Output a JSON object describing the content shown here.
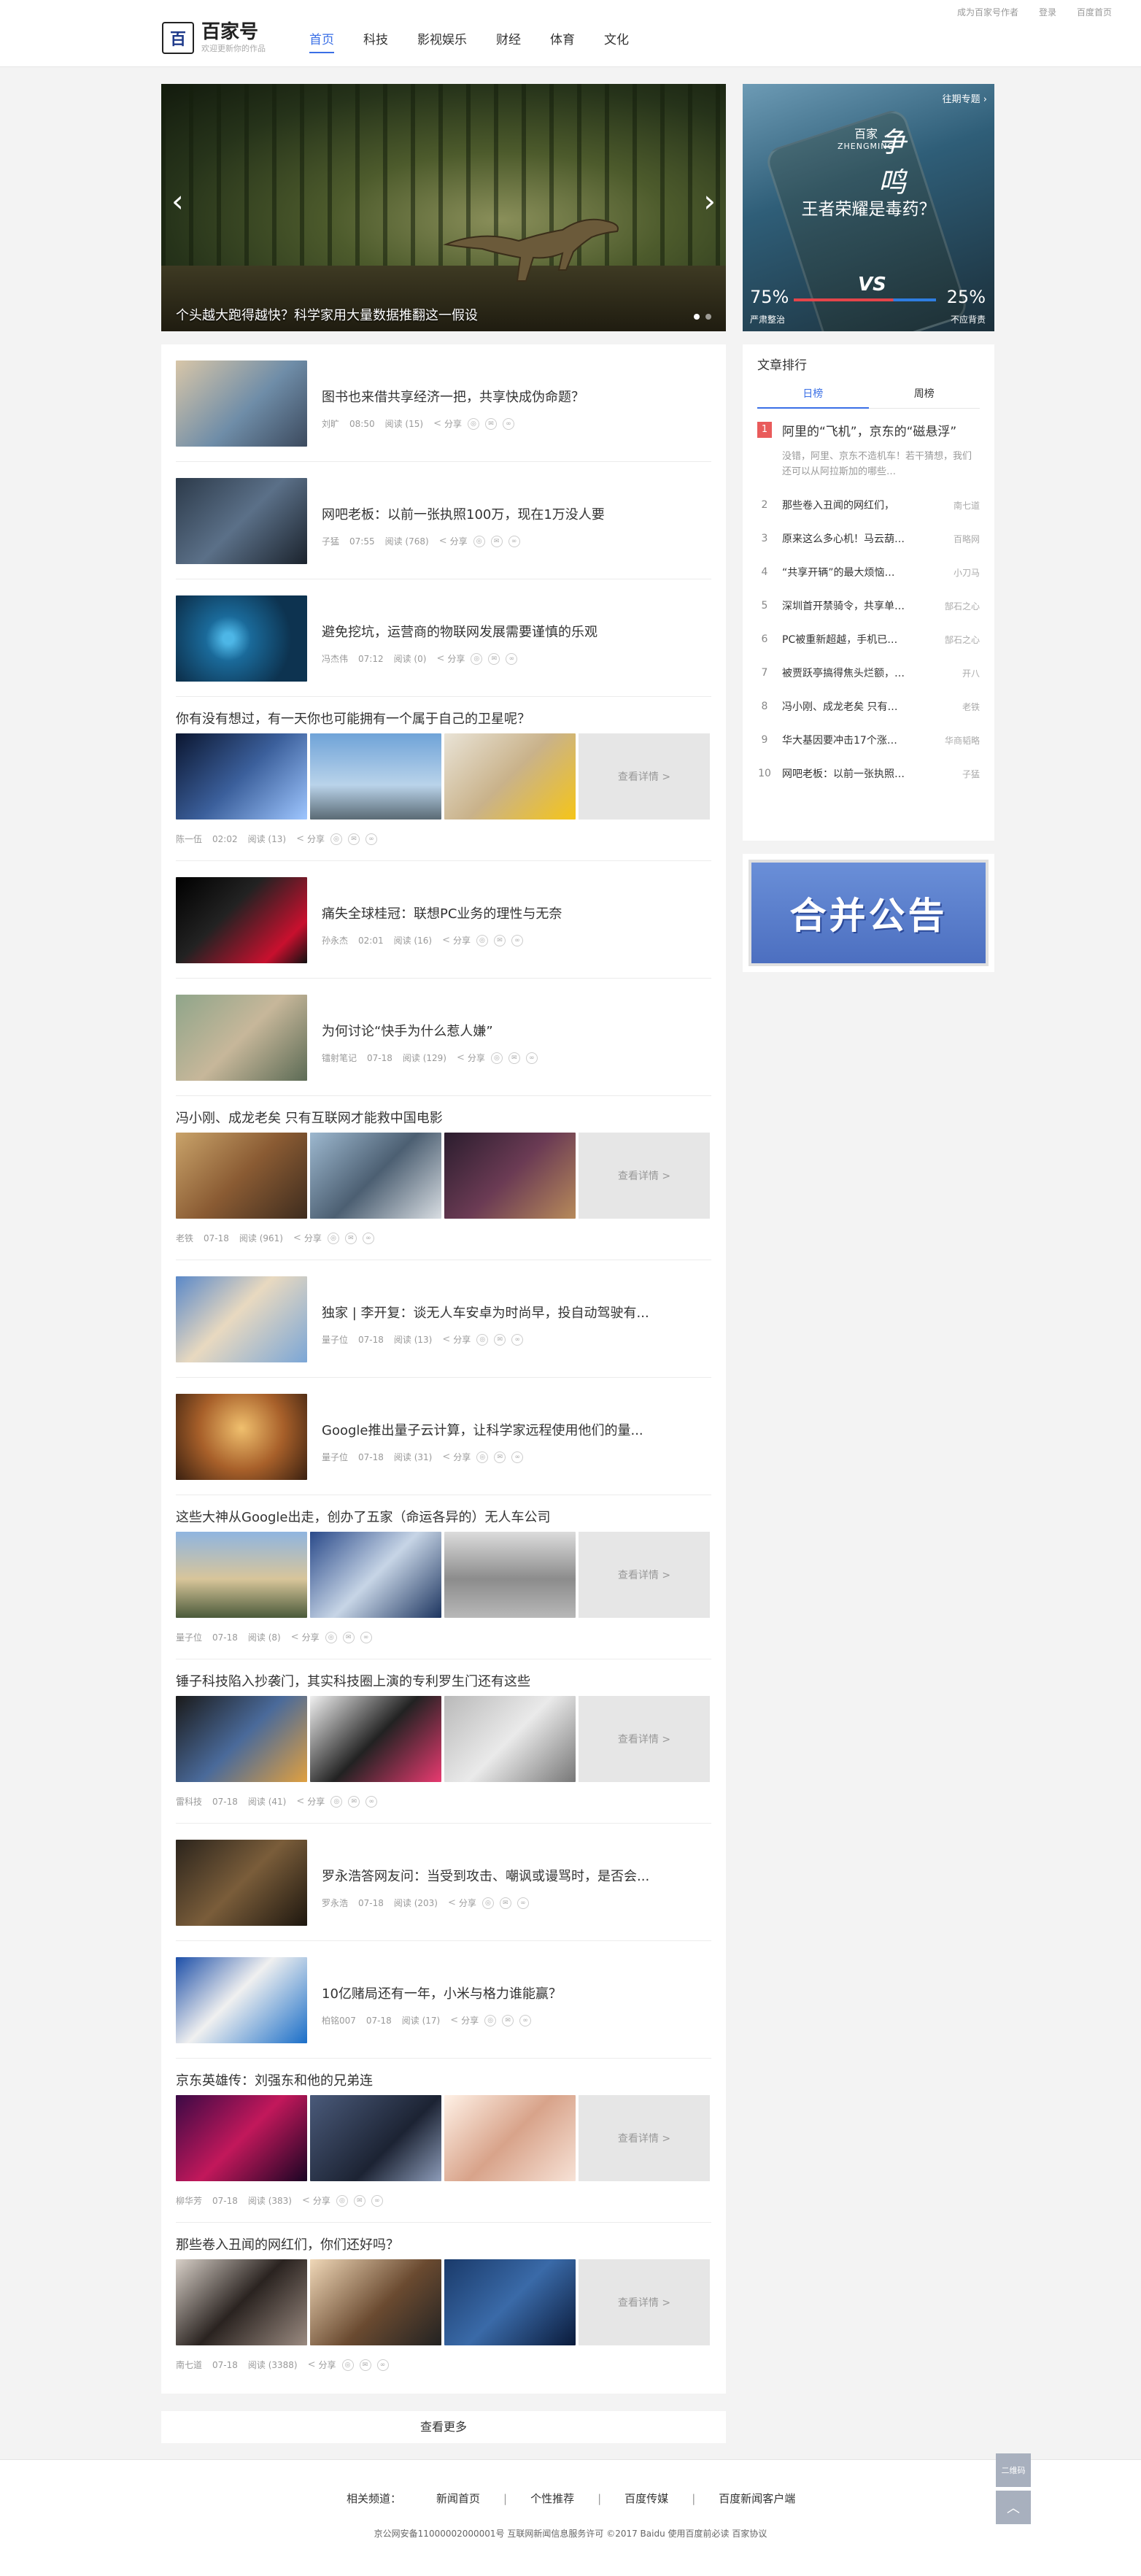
{
  "header": {
    "toplinks": [
      "成为百家号作者",
      "登录",
      "百度首页"
    ],
    "logo_mark": "百",
    "logo_title": "百家号",
    "logo_sub": "欢迎更新你的作品",
    "nav": [
      "首页",
      "科技",
      "影视娱乐",
      "财经",
      "体育",
      "文化"
    ]
  },
  "hero": {
    "caption": "个头越大跑得越快？科学家用大量数据推翻这一假设",
    "prev": "‹",
    "next": "›"
  },
  "special": {
    "top_link": "往期专题 ›",
    "brand": "百家",
    "brand_en": "ZHENGMING",
    "brand_script": "争鸣",
    "question": "王者荣耀是毒药？",
    "vs": "VS",
    "left_pct": "75%",
    "right_pct": "25%",
    "left_label": "严肃整治",
    "right_label": "不应背责"
  },
  "feed": {
    "share_label": "分享",
    "more_label": "查看详情 >",
    "items": [
      {
        "title": "图书也来借共享经济一把，共享快成伪命题？",
        "author": "刘旷",
        "time": "08:50",
        "reads": "阅读 (15)"
      },
      {
        "title": "网吧老板：以前一张执照100万，现在1万没人要",
        "author": "子猛",
        "time": "07:55",
        "reads": "阅读 (768)"
      },
      {
        "title": "避免挖坑，运营商的物联网发展需要谨慎的乐观",
        "author": "冯杰伟",
        "time": "07:12",
        "reads": "阅读 (0)"
      },
      {
        "title": "你有没有想过，有一天你也可能拥有一个属于自己的卫星呢？",
        "author": "陈一伍",
        "time": "02:02",
        "reads": "阅读 (13)"
      },
      {
        "title": "痛失全球桂冠：联想PC业务的理性与无奈",
        "author": "孙永杰",
        "time": "02:01",
        "reads": "阅读 (16)"
      },
      {
        "title": "为何讨论“快手为什么惹人嫌”",
        "author": "镭射笔记",
        "time": "07-18",
        "reads": "阅读 (129)"
      },
      {
        "title": "冯小刚、成龙老矣 只有互联网才能救中国电影",
        "author": "老铁",
        "time": "07-18",
        "reads": "阅读 (961)"
      },
      {
        "title": "独家 | 李开复：谈无人车安卓为时尚早，投自动驾驶有...",
        "author": "量子位",
        "time": "07-18",
        "reads": "阅读 (13)"
      },
      {
        "title": "Google推出量子云计算，让科学家远程使用他们的量...",
        "author": "量子位",
        "time": "07-18",
        "reads": "阅读 (31)"
      },
      {
        "title": "这些大神从Google出走，创办了五家（命运各异的）无人车公司",
        "author": "量子位",
        "time": "07-18",
        "reads": "阅读 (8)"
      },
      {
        "title": "锤子科技陷入抄袭门，其实科技圈上演的专利罗生门还有这些",
        "author": "雷科技",
        "time": "07-18",
        "reads": "阅读 (41)"
      },
      {
        "title": "罗永浩答网友问：当受到攻击、嘲讽或谩骂时，是否会...",
        "author": "罗永浩",
        "time": "07-18",
        "reads": "阅读 (203)"
      },
      {
        "title": "10亿赌局还有一年，小米与格力谁能赢？",
        "author": "柏铭007",
        "time": "07-18",
        "reads": "阅读 (17)"
      },
      {
        "title": "京东英雄传：刘强东和他的兄弟连",
        "author": "柳华芳",
        "time": "07-18",
        "reads": "阅读 (383)"
      },
      {
        "title": "那些卷入丑闻的网红们，你们还好吗？",
        "author": "南七道",
        "time": "07-18",
        "reads": "阅读 (3388)"
      }
    ],
    "load_more": "查看更多"
  },
  "rank": {
    "title": "文章排行",
    "tabs": [
      "日榜",
      "周榜"
    ],
    "first": {
      "num": "1",
      "title": "阿里的“飞机”，京东的“磁悬浮”",
      "desc": "没错，阿里、京东不造机车！若干猜想，我们还可以从阿拉斯加的哪些…"
    },
    "items": [
      {
        "num": "2",
        "title": "那些卷入丑闻的网红们，",
        "src": "南七道"
      },
      {
        "num": "3",
        "title": "原来这么多心机！马云葫…",
        "src": "百略网"
      },
      {
        "num": "4",
        "title": "“共享开辆”的最大烦恼…",
        "src": "小刀马"
      },
      {
        "num": "5",
        "title": "深圳首开禁骑令，共享单…",
        "src": "郜石之心"
      },
      {
        "num": "6",
        "title": "PC被重新超越，手机已…",
        "src": "郜石之心"
      },
      {
        "num": "7",
        "title": "被贾跃亭搞得焦头烂额，…",
        "src": "开八"
      },
      {
        "num": "8",
        "title": "冯小刚、成龙老矣 只有…",
        "src": "老铁"
      },
      {
        "num": "9",
        "title": "华大基因要冲击17个涨…",
        "src": "华商韬略"
      },
      {
        "num": "10",
        "title": "网吧老板：以前一张执照…",
        "src": "子猛"
      }
    ]
  },
  "notice": {
    "text": "合并公告"
  },
  "footer": {
    "label": "相关频道：",
    "links": [
      "新闻首页",
      "个性推荐",
      "百度传媒",
      "百度新闻客户端"
    ],
    "sep": "|",
    "copy": "京公网安备11000002000001号 互联网新闻信息服务许可 ©2017 Baidu 使用百度前必读 百家协议",
    "qr_label": "二维码",
    "top_label": "︿"
  }
}
